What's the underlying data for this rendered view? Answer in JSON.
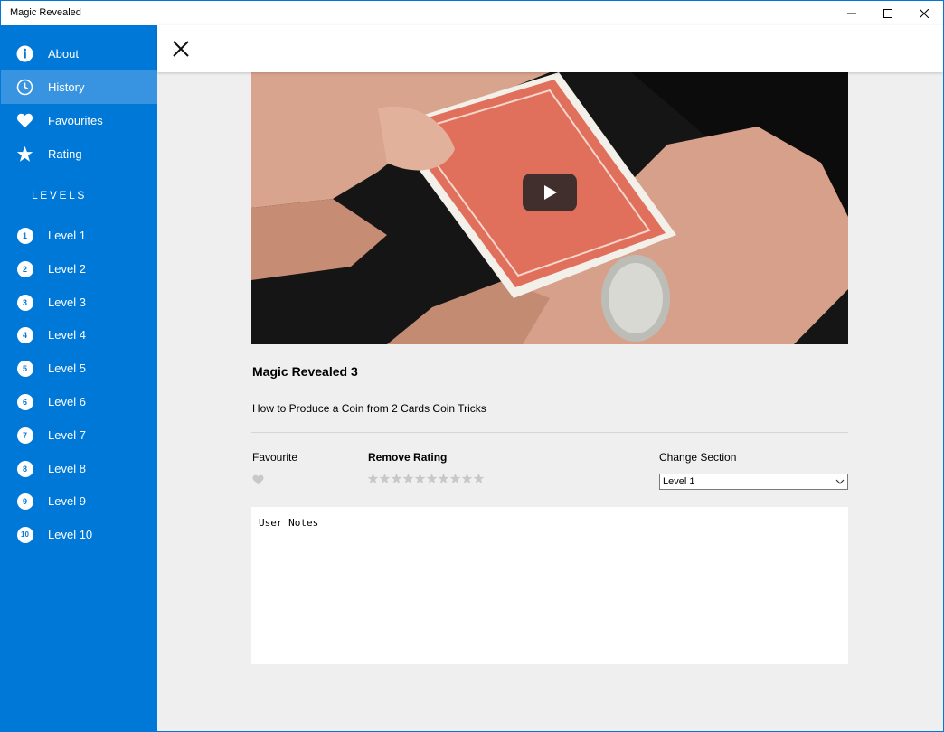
{
  "window": {
    "title": "Magic Revealed"
  },
  "sidebar": {
    "nav": [
      {
        "label": "About",
        "icon": "info-icon"
      },
      {
        "label": "History",
        "icon": "clock-icon",
        "active": true
      },
      {
        "label": "Favourites",
        "icon": "heart-icon"
      },
      {
        "label": "Rating",
        "icon": "star-icon"
      }
    ],
    "levels_header": "LEVELS",
    "levels": [
      {
        "num": "1",
        "label": "Level 1"
      },
      {
        "num": "2",
        "label": "Level 2"
      },
      {
        "num": "3",
        "label": "Level 3"
      },
      {
        "num": "4",
        "label": "Level 4"
      },
      {
        "num": "5",
        "label": "Level 5"
      },
      {
        "num": "6",
        "label": "Level 6"
      },
      {
        "num": "7",
        "label": "Level 7"
      },
      {
        "num": "8",
        "label": "Level 8"
      },
      {
        "num": "9",
        "label": "Level 9"
      },
      {
        "num": "10",
        "label": "Level 10"
      }
    ]
  },
  "detail": {
    "title": "Magic Revealed 3",
    "description": "How to Produce a Coin from 2 Cards Coin Tricks",
    "favourite_label": "Favourite",
    "rating_label": "Remove Rating",
    "rating_value": 0,
    "rating_max": 10,
    "section_label": "Change Section",
    "section_value": "Level 1",
    "notes_placeholder": "User Notes"
  },
  "colors": {
    "accent": "#0078d7",
    "active_item": "#3893e0",
    "panel_bg": "#efefef",
    "star_empty": "#c8c8c8"
  }
}
